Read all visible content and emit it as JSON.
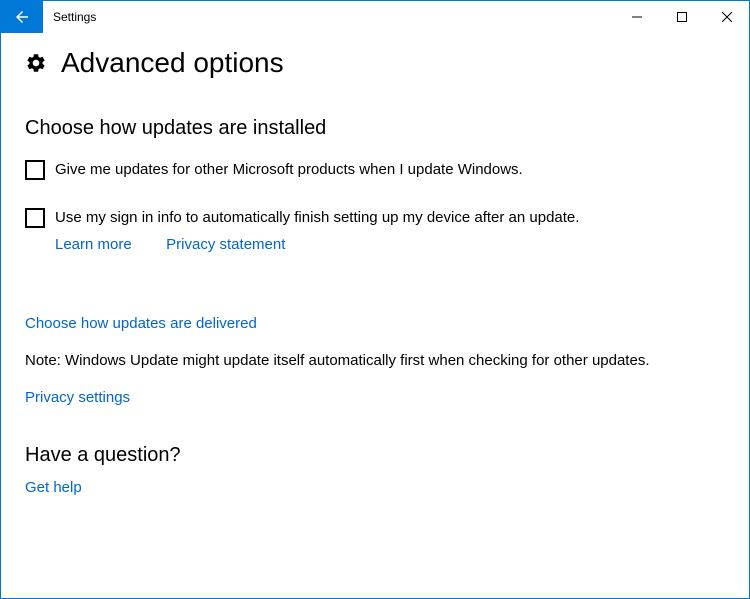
{
  "window": {
    "title": "Settings"
  },
  "page": {
    "title": "Advanced options"
  },
  "section1": {
    "heading": "Choose how updates are installed",
    "checkbox1_label": "Give me updates for other Microsoft products when I update Windows.",
    "checkbox2_label": "Use my sign in info to automatically finish setting up my device after an update.",
    "learn_more": "Learn more",
    "privacy_statement": "Privacy statement"
  },
  "links": {
    "delivered": "Choose how updates are delivered",
    "privacy_settings": "Privacy settings"
  },
  "note": "Note: Windows Update might update itself automatically first when checking for other updates.",
  "question": {
    "heading": "Have a question?",
    "get_help": "Get help"
  }
}
